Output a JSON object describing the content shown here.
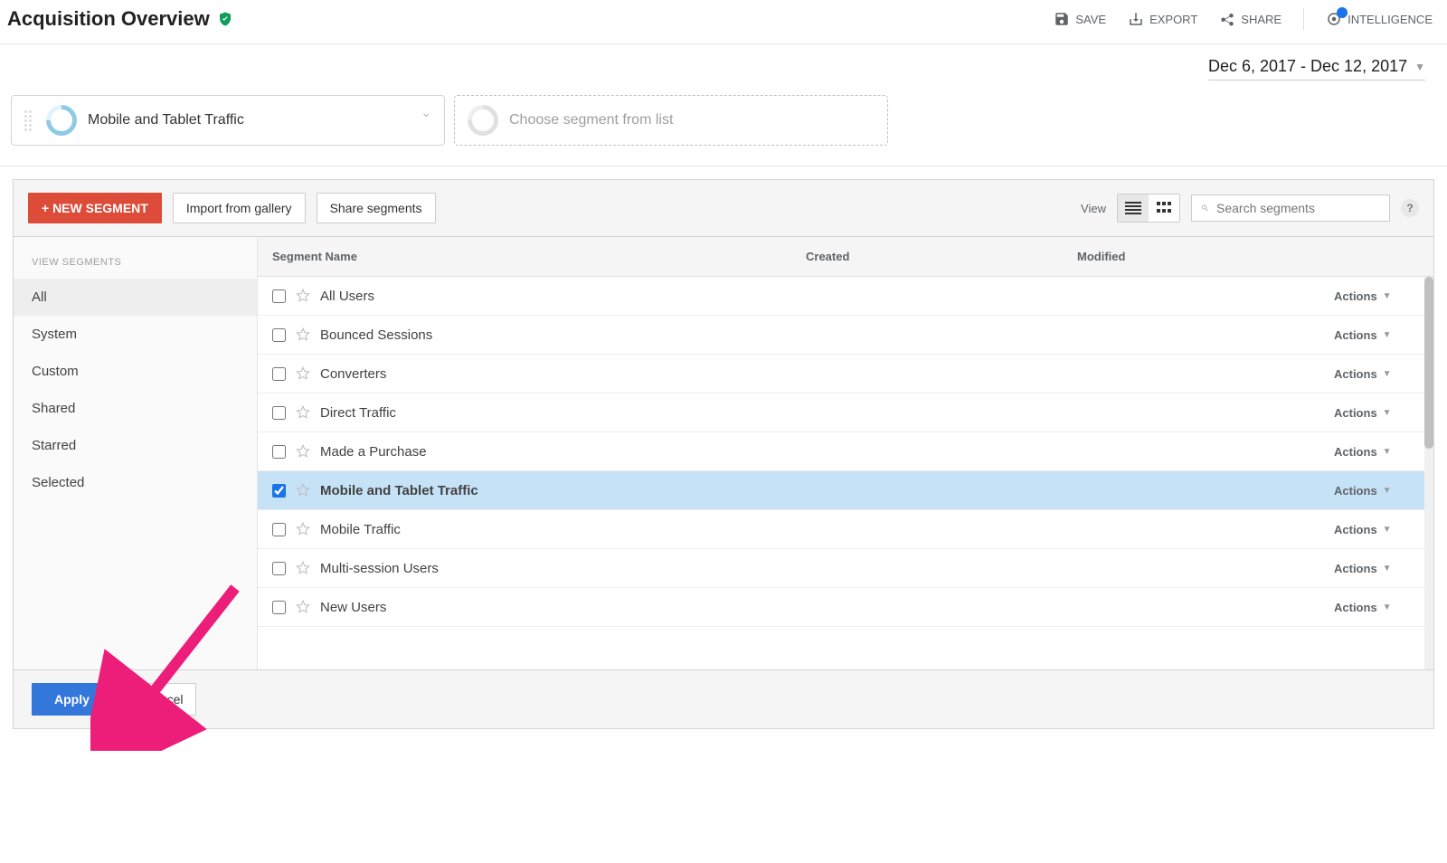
{
  "page": {
    "title": "Acquisition Overview"
  },
  "header": {
    "save": "SAVE",
    "export": "EXPORT",
    "share": "SHARE",
    "intelligence": "INTELLIGENCE"
  },
  "date_range": "Dec 6, 2017 - Dec 12, 2017",
  "segment_pill": {
    "selected": "Mobile and Tablet Traffic",
    "placeholder": "Choose segment from list"
  },
  "toolbar": {
    "new_segment": "+ NEW SEGMENT",
    "import": "Import from gallery",
    "share": "Share segments",
    "view_label": "View",
    "search_placeholder": "Search segments"
  },
  "sidebar": {
    "heading": "VIEW SEGMENTS",
    "items": [
      "All",
      "System",
      "Custom",
      "Shared",
      "Starred",
      "Selected"
    ],
    "active_index": 0
  },
  "table": {
    "columns": {
      "name": "Segment Name",
      "created": "Created",
      "modified": "Modified"
    },
    "actions_label": "Actions",
    "rows": [
      {
        "name": "All Users",
        "selected": false
      },
      {
        "name": "Bounced Sessions",
        "selected": false
      },
      {
        "name": "Converters",
        "selected": false
      },
      {
        "name": "Direct Traffic",
        "selected": false
      },
      {
        "name": "Made a Purchase",
        "selected": false
      },
      {
        "name": "Mobile and Tablet Traffic",
        "selected": true
      },
      {
        "name": "Mobile Traffic",
        "selected": false
      },
      {
        "name": "Multi-session Users",
        "selected": false
      },
      {
        "name": "New Users",
        "selected": false
      }
    ]
  },
  "footer": {
    "apply": "Apply",
    "cancel": "Cancel"
  }
}
